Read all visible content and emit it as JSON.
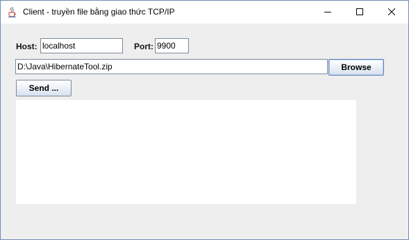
{
  "window": {
    "title": "Client - truyền file bằng giao thức TCP/IP",
    "icon": "java-cup-icon",
    "controls": [
      "minimize-icon",
      "maximize-icon",
      "close-icon"
    ]
  },
  "form": {
    "host_label": "Host:",
    "host_value": "localhost",
    "port_label": "Port:",
    "port_value": "9900",
    "file_path": "D:\\Java\\HibernateTool.zip",
    "browse_label": "Browse",
    "send_label": "Send ..."
  },
  "output": {
    "text": ""
  }
}
